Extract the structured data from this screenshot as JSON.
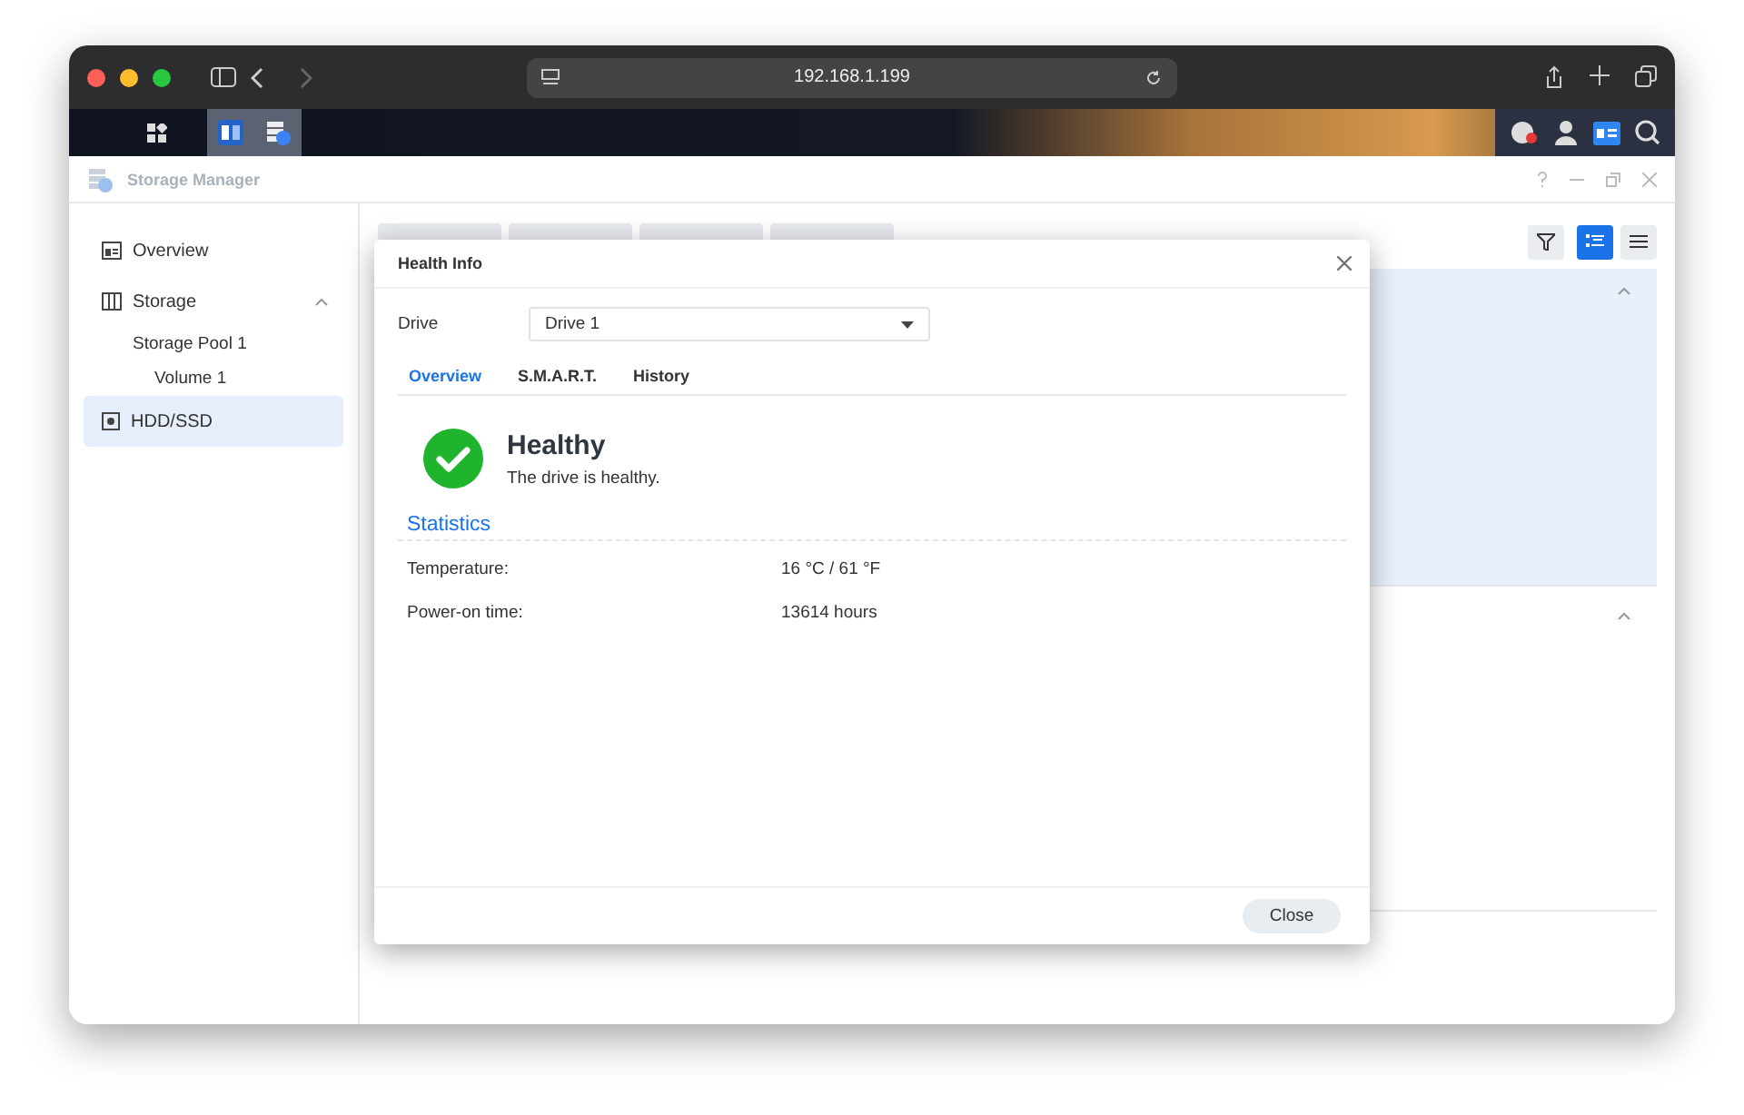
{
  "browser": {
    "address": "192.168.1.199"
  },
  "app": {
    "title": "Storage Manager"
  },
  "sidebar": {
    "items": [
      {
        "label": "Overview",
        "selected": false
      },
      {
        "label": "Storage",
        "selected": false,
        "expanded": true,
        "children": [
          {
            "label": "Storage Pool 1",
            "children": [
              {
                "label": "Volume 1"
              }
            ]
          }
        ]
      },
      {
        "label": "HDD/SSD",
        "selected": true
      }
    ]
  },
  "view_buttons": [
    {
      "kind": "detail",
      "selected": true
    },
    {
      "kind": "list",
      "selected": false
    }
  ],
  "sections": [
    {
      "expanded": true,
      "selected": true
    },
    {
      "expanded": true,
      "selected": false
    }
  ],
  "dialog": {
    "title": "Health Info",
    "drive_label": "Drive",
    "drive_value": "Drive 1",
    "tabs": [
      {
        "label": "Overview",
        "selected": true
      },
      {
        "label": "S.M.A.R.T.",
        "selected": false
      },
      {
        "label": "History",
        "selected": false
      }
    ],
    "status": {
      "title": "Healthy",
      "message": "The drive is healthy."
    },
    "section_title": "Statistics",
    "stats": [
      {
        "label": "Temperature:",
        "value": "16 °C / 61 °F"
      },
      {
        "label": "Power-on time:",
        "value": "13614 hours"
      }
    ],
    "button": "Close"
  }
}
